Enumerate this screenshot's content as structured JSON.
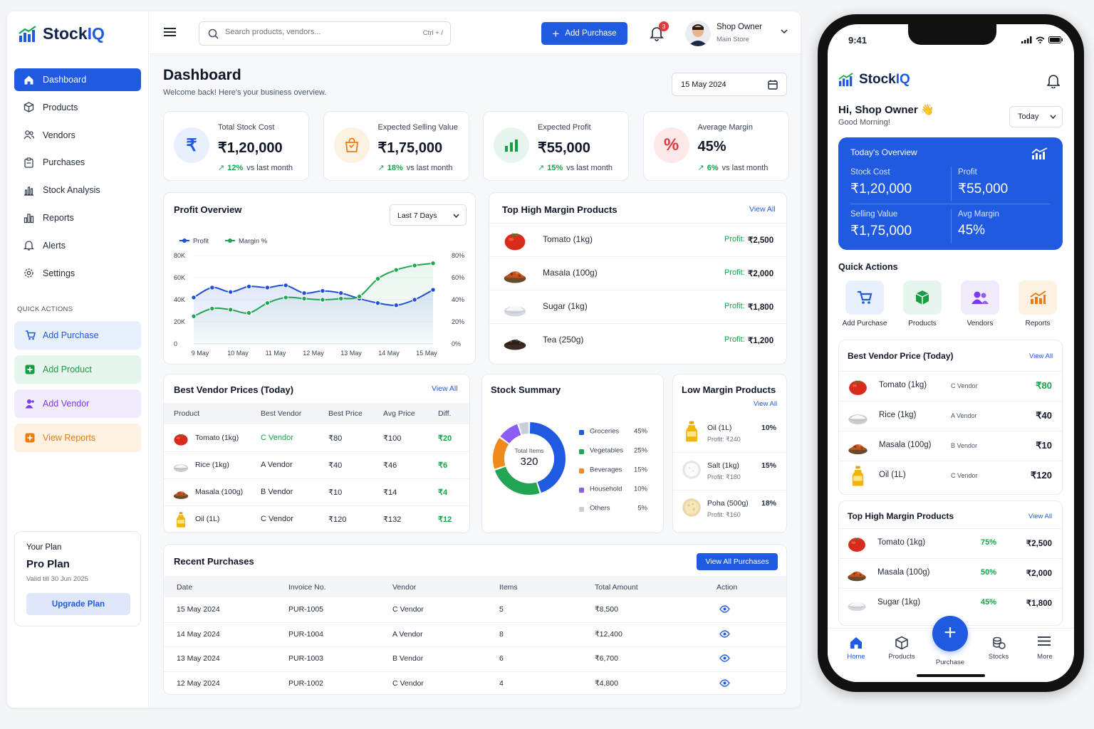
{
  "app": {
    "name": "StockIQ"
  },
  "search": {
    "placeholder": "Search products, vendors...",
    "shortcut": "Ctrl + /"
  },
  "header": {
    "add_purchase": "Add Purchase",
    "notif_count": "3",
    "user_name": "Shop Owner",
    "user_role": "Main Store"
  },
  "sidebar": {
    "items": [
      {
        "label": "Dashboard",
        "icon": "home-icon"
      },
      {
        "label": "Products",
        "icon": "box-icon"
      },
      {
        "label": "Vendors",
        "icon": "users-icon"
      },
      {
        "label": "Purchases",
        "icon": "clipboard-icon"
      },
      {
        "label": "Stock Analysis",
        "icon": "analysis-icon"
      },
      {
        "label": "Reports",
        "icon": "bar-chart-icon"
      },
      {
        "label": "Alerts",
        "icon": "bell-icon"
      },
      {
        "label": "Settings",
        "icon": "gear-icon"
      }
    ],
    "quick_actions_title": "QUICK ACTIONS",
    "quick_actions": [
      {
        "label": "Add Purchase",
        "color": "#1f5ae0",
        "bg": "#e8effd"
      },
      {
        "label": "Add Product",
        "color": "#1a9c45",
        "bg": "#e7f6ec"
      },
      {
        "label": "Add Vendor",
        "color": "#7c3aed",
        "bg": "#f1ebfc"
      },
      {
        "label": "View Reports",
        "color": "#ea7c12",
        "bg": "#fdf1e2"
      }
    ],
    "plan": {
      "title": "Your Plan",
      "name": "Pro Plan",
      "valid": "Valid till 30 Jun 2025",
      "button": "Upgrade Plan"
    }
  },
  "page": {
    "title": "Dashboard",
    "subtitle": "Welcome back! Here's your business overview.",
    "date": "15 May 2024"
  },
  "kpis": [
    {
      "label": "Total Stock Cost",
      "value": "₹1,20,000",
      "change": "12%",
      "suffix": "vs last month",
      "icon": "rupee-icon",
      "color": "#1f5ae0",
      "bg": "#e8effd"
    },
    {
      "label": "Expected Selling Value",
      "value": "₹1,75,000",
      "change": "18%",
      "suffix": "vs last month",
      "icon": "bag-icon",
      "color": "#ea7c12",
      "bg": "#fdf1e2"
    },
    {
      "label": "Expected Profit",
      "value": "₹55,000",
      "change": "15%",
      "suffix": "vs last month",
      "icon": "bar-chart-icon",
      "color": "#1a9c45",
      "bg": "#e7f6ec"
    },
    {
      "label": "Average Margin",
      "value": "45%",
      "change": "6%",
      "suffix": "vs last month",
      "icon": "percent-icon",
      "color": "#e0393e",
      "bg": "#fde9ea"
    }
  ],
  "profit_overview": {
    "title": "Profit Overview",
    "range": "Last 7 Days",
    "chart_data": {
      "type": "line",
      "x": [
        "9 May",
        "10 May",
        "11 May",
        "12 May",
        "13 May",
        "14 May",
        "15 May"
      ],
      "series": [
        {
          "name": "Profit",
          "axis": "left",
          "color": "#1f4fd8",
          "values": [
            42000,
            51000,
            47000,
            52000,
            51000,
            53000,
            46000,
            48000,
            46000,
            41000,
            37000,
            35000,
            40000,
            49000
          ]
        },
        {
          "name": "Margin %",
          "axis": "right",
          "color": "#22a552",
          "values": [
            25,
            32,
            31,
            28,
            37,
            42,
            41,
            40,
            41,
            43,
            59,
            67,
            71,
            73
          ]
        }
      ],
      "y_left": {
        "ticks": [
          "80K",
          "60K",
          "40K",
          "20K",
          "0"
        ],
        "range": [
          0,
          80000
        ]
      },
      "y_right": {
        "ticks": [
          "80%",
          "60%",
          "40%",
          "20%",
          "0%"
        ],
        "range": [
          0,
          80
        ]
      }
    }
  },
  "top_margin": {
    "title": "Top High Margin Products",
    "view_all": "View All",
    "profit_label": "Profit:",
    "items": [
      {
        "name": "Tomato (1kg)",
        "profit": "₹2,500",
        "food": "tomato"
      },
      {
        "name": "Masala (100g)",
        "profit": "₹2,000",
        "food": "masala"
      },
      {
        "name": "Sugar (1kg)",
        "profit": "₹1,800",
        "food": "sugar"
      },
      {
        "name": "Tea (250g)",
        "profit": "₹1,200",
        "food": "tea"
      }
    ]
  },
  "vendor_prices": {
    "title": "Best Vendor Prices (Today)",
    "view_all": "View All",
    "headers": [
      "Product",
      "Best Vendor",
      "Best Price",
      "Avg Price",
      "Diff."
    ],
    "rows": [
      {
        "product": "Tomato (1kg)",
        "vendor": "C Vendor",
        "best": "₹80",
        "avg": "₹100",
        "diff": "₹20",
        "food": "tomato"
      },
      {
        "product": "Rice (1kg)",
        "vendor": "A Vendor",
        "best": "₹40",
        "avg": "₹46",
        "diff": "₹6",
        "food": "rice"
      },
      {
        "product": "Masala (100g)",
        "vendor": "B Vendor",
        "best": "₹10",
        "avg": "₹14",
        "diff": "₹4",
        "food": "masala"
      },
      {
        "product": "Oil (1L)",
        "vendor": "C Vendor",
        "best": "₹120",
        "avg": "₹132",
        "diff": "₹12",
        "food": "oil"
      }
    ]
  },
  "stock_summary": {
    "title": "Stock Summary",
    "center_label": "Total Items",
    "center_value": "320",
    "chart_data": {
      "type": "pie",
      "categories": [
        "Groceries",
        "Vegetables",
        "Beverages",
        "Household",
        "Others"
      ],
      "values": [
        45,
        25,
        15,
        10,
        5
      ],
      "labels": [
        "45%",
        "25%",
        "15%",
        "10%",
        "5%"
      ],
      "colors": [
        "#1f5ae0",
        "#22a552",
        "#f08a1c",
        "#8b5cf6",
        "#c9cfda"
      ]
    }
  },
  "low_margin": {
    "title": "Low Margin Products",
    "view_all": "View All",
    "items": [
      {
        "name": "Oil (1L)",
        "profit": "Profit: ₹240",
        "margin": "10%",
        "food": "oil"
      },
      {
        "name": "Salt (1kg)",
        "profit": "Profit: ₹180",
        "margin": "15%",
        "food": "salt"
      },
      {
        "name": "Poha (500g)",
        "profit": "Profit: ₹160",
        "margin": "18%",
        "food": "poha"
      }
    ]
  },
  "recent_purchases": {
    "title": "Recent Purchases",
    "button": "View All Purchases",
    "headers": [
      "Date",
      "Invoice No.",
      "Vendor",
      "Items",
      "Total Amount",
      "Action"
    ],
    "rows": [
      {
        "date": "15 May 2024",
        "invoice": "PUR-1005",
        "vendor": "C Vendor",
        "items": "5",
        "amount": "₹8,500"
      },
      {
        "date": "14 May 2024",
        "invoice": "PUR-1004",
        "vendor": "A Vendor",
        "items": "8",
        "amount": "₹12,400"
      },
      {
        "date": "13 May 2024",
        "invoice": "PUR-1003",
        "vendor": "B Vendor",
        "items": "6",
        "amount": "₹6,700"
      },
      {
        "date": "12 May 2024",
        "invoice": "PUR-1002",
        "vendor": "C Vendor",
        "items": "4",
        "amount": "₹4,800"
      }
    ]
  },
  "mobile": {
    "time": "9:41",
    "greeting": "Hi, Shop Owner 👋",
    "sub": "Good Morning!",
    "range": "Today",
    "overview": {
      "title": "Today's Overview",
      "stock_label": "Stock Cost",
      "stock": "₹1,20,000",
      "profit_label": "Profit",
      "profit": "₹55,000",
      "selling_label": "Selling Value",
      "selling": "₹1,75,000",
      "margin_label": "Avg Margin",
      "margin": "45%"
    },
    "quick_title": "Quick Actions",
    "quick": [
      {
        "label": "Add Purchase",
        "color": "#1f5ae0",
        "bg": "#e8effd"
      },
      {
        "label": "Products",
        "color": "#1a9c45",
        "bg": "#e7f6ec"
      },
      {
        "label": "Vendors",
        "color": "#7c3aed",
        "bg": "#f1ebfc"
      },
      {
        "label": "Reports",
        "color": "#ea7c12",
        "bg": "#fdf1e2"
      }
    ],
    "vendor": {
      "title": "Best Vendor Price (Today)",
      "view_all": "View All",
      "rows": [
        {
          "name": "Tomato (1kg)",
          "vendor": "C Vendor",
          "price": "₹80",
          "food": "tomato"
        },
        {
          "name": "Rice (1kg)",
          "vendor": "A Vendor",
          "price": "₹40",
          "food": "rice"
        },
        {
          "name": "Masala (100g)",
          "vendor": "B Vendor",
          "price": "₹10",
          "food": "masala"
        },
        {
          "name": "Oil (1L)",
          "vendor": "C Vendor",
          "price": "₹120",
          "food": "oil"
        }
      ]
    },
    "top": {
      "title": "Top High Margin Products",
      "view_all": "View All",
      "rows": [
        {
          "name": "Tomato (1kg)",
          "margin": "75%",
          "profit": "₹2,500",
          "food": "tomato"
        },
        {
          "name": "Masala (100g)",
          "margin": "50%",
          "profit": "₹2,000",
          "food": "masala"
        },
        {
          "name": "Sugar (1kg)",
          "margin": "45%",
          "profit": "₹1,800",
          "food": "sugar"
        }
      ]
    },
    "tabs": [
      {
        "label": "Home",
        "icon": "home-icon"
      },
      {
        "label": "Products",
        "icon": "box-icon"
      },
      {
        "label": "Purchase",
        "icon": "plus-icon"
      },
      {
        "label": "Stocks",
        "icon": "stocks-icon"
      },
      {
        "label": "More",
        "icon": "menu-icon"
      }
    ]
  }
}
